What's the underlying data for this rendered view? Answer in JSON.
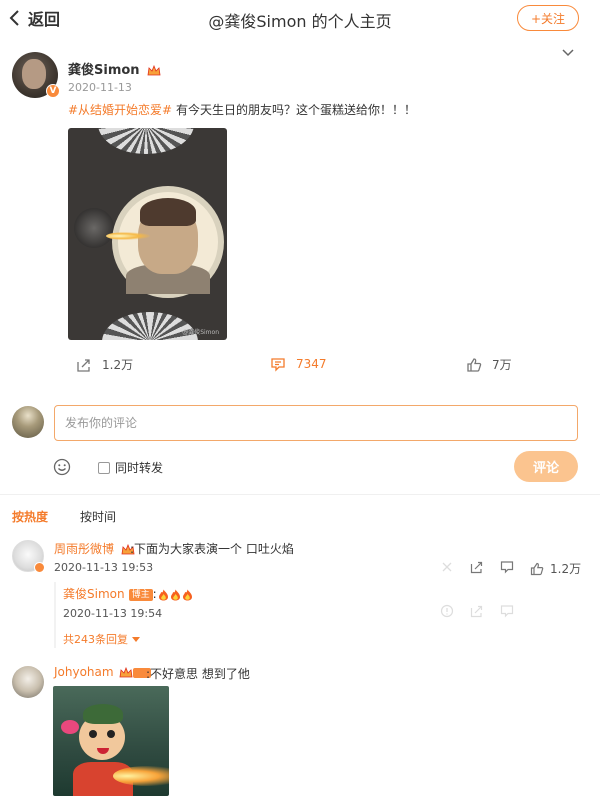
{
  "header": {
    "back_label": "返回",
    "title": "@龚俊Simon 的个人主页",
    "follow_label": "+关注"
  },
  "post": {
    "author": "龚俊Simon",
    "date": "2020-11-13",
    "hashtag": "#从结婚开始恋爱#",
    "text": " 有今天生日的朋友吗？这个蛋糕送给你！！！",
    "image_watermark": "@龚俊Simon",
    "actions": {
      "share_count": "1.2万",
      "comment_count": "7347",
      "like_count": "7万"
    }
  },
  "composer": {
    "placeholder": "发布你的评论",
    "repost_label": "同时转发",
    "submit_label": "评论"
  },
  "sort": {
    "hot": "按热度",
    "time": "按时间"
  },
  "comments": [
    {
      "name": "周雨彤微博",
      "text": ":下面为大家表演一个 口吐火焰",
      "date": "2020-11-13 19:53",
      "like_count": "1.2万",
      "reply": {
        "name": "龚俊Simon",
        "tag": "博主",
        "date": "2020-11-13 19:54",
        "more_label": "共243条回复"
      }
    },
    {
      "name": "Johyoham",
      "text": ":不好意思 想到了他"
    }
  ],
  "colors": {
    "accent": "#f47b2b",
    "submit_bg": "#fbc48f"
  }
}
